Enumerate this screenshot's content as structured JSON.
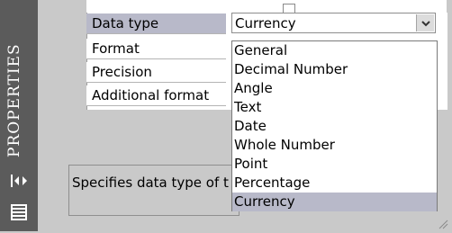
{
  "sidebar": {
    "title": "PROPERTIES"
  },
  "properties": [
    {
      "label": "Data type",
      "selected": true
    },
    {
      "label": "Format",
      "selected": false
    },
    {
      "label": "Precision",
      "selected": false
    },
    {
      "label": "Additional format",
      "selected": false
    }
  ],
  "combo": {
    "value": "Currency"
  },
  "dropdown": {
    "options": [
      "General",
      "Decimal Number",
      "Angle",
      "Text",
      "Date",
      "Whole Number",
      "Point",
      "Percentage",
      "Currency"
    ],
    "selected_index": 8
  },
  "description": {
    "text": "Specifies data type of t"
  },
  "colors": {
    "sidebar": "#5b5b5b",
    "panel": "#c9c9c9",
    "selection": "#b8b9c9"
  },
  "icons": [
    "collapse-arrows-icon",
    "properties-list-icon",
    "chevron-down-icon",
    "resize-grip-icon"
  ]
}
